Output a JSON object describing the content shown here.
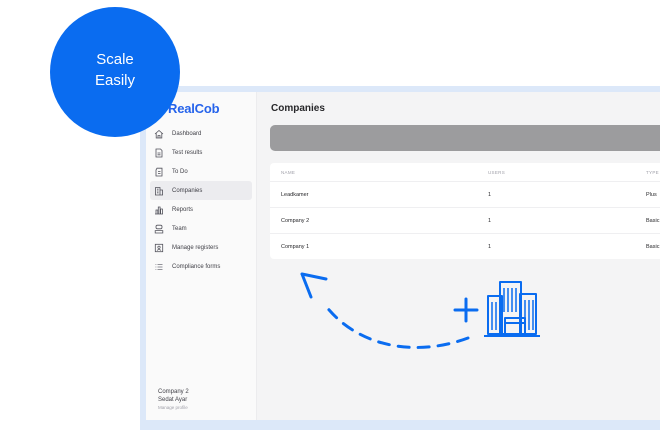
{
  "bubble": {
    "line1": "Scale",
    "line2": "Easily"
  },
  "app": {
    "logo": "RealCob",
    "nav": [
      {
        "label": "Dashboard",
        "icon": "home-icon"
      },
      {
        "label": "Test results",
        "icon": "document-icon"
      },
      {
        "label": "To Do",
        "icon": "clipboard-icon"
      },
      {
        "label": "Companies",
        "icon": "building-icon",
        "active": true
      },
      {
        "label": "Reports",
        "icon": "bar-chart-icon"
      },
      {
        "label": "Team",
        "icon": "users-icon"
      },
      {
        "label": "Manage registers",
        "icon": "register-icon"
      },
      {
        "label": "Compliance forms",
        "icon": "list-icon"
      }
    ],
    "footer": {
      "company": "Company 2",
      "user": "Sedat Ayar",
      "manage": "Manage profile"
    }
  },
  "main": {
    "title": "Companies",
    "table": {
      "headers": [
        "NAME",
        "USERS",
        "TYPE"
      ],
      "rows": [
        [
          "Leadkamer",
          "1",
          "Plus"
        ],
        [
          "Company 2",
          "1",
          "Basic"
        ],
        [
          "Company 1",
          "1",
          "Basic"
        ]
      ]
    }
  },
  "colors": {
    "accent": "#0a6cf0",
    "brand": "#2563eb",
    "frame": "#dce8f9"
  },
  "illustration": {
    "plus": "plus-icon",
    "building": "buildings-icon",
    "arrow": "dashed-curved-arrow"
  }
}
